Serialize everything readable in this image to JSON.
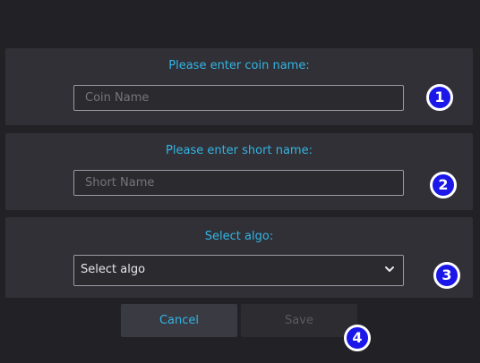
{
  "form": {
    "coin": {
      "label": "Please enter coin name:",
      "placeholder": "Coin Name",
      "value": ""
    },
    "short": {
      "label": "Please enter short name:",
      "placeholder": "Short Name",
      "value": ""
    },
    "algo": {
      "label": "Select algo:",
      "selected": "Select algo",
      "icon": "chevron-down-icon"
    }
  },
  "buttons": {
    "cancel_label": "Cancel",
    "save_label": "Save",
    "save_enabled": false
  },
  "annotations": {
    "badge1": "1",
    "badge2": "2",
    "badge3": "3",
    "badge4": "4"
  },
  "colors": {
    "accent": "#33b5e5",
    "background": "#222226",
    "panel": "#303036",
    "badge": "#1a17e8"
  }
}
